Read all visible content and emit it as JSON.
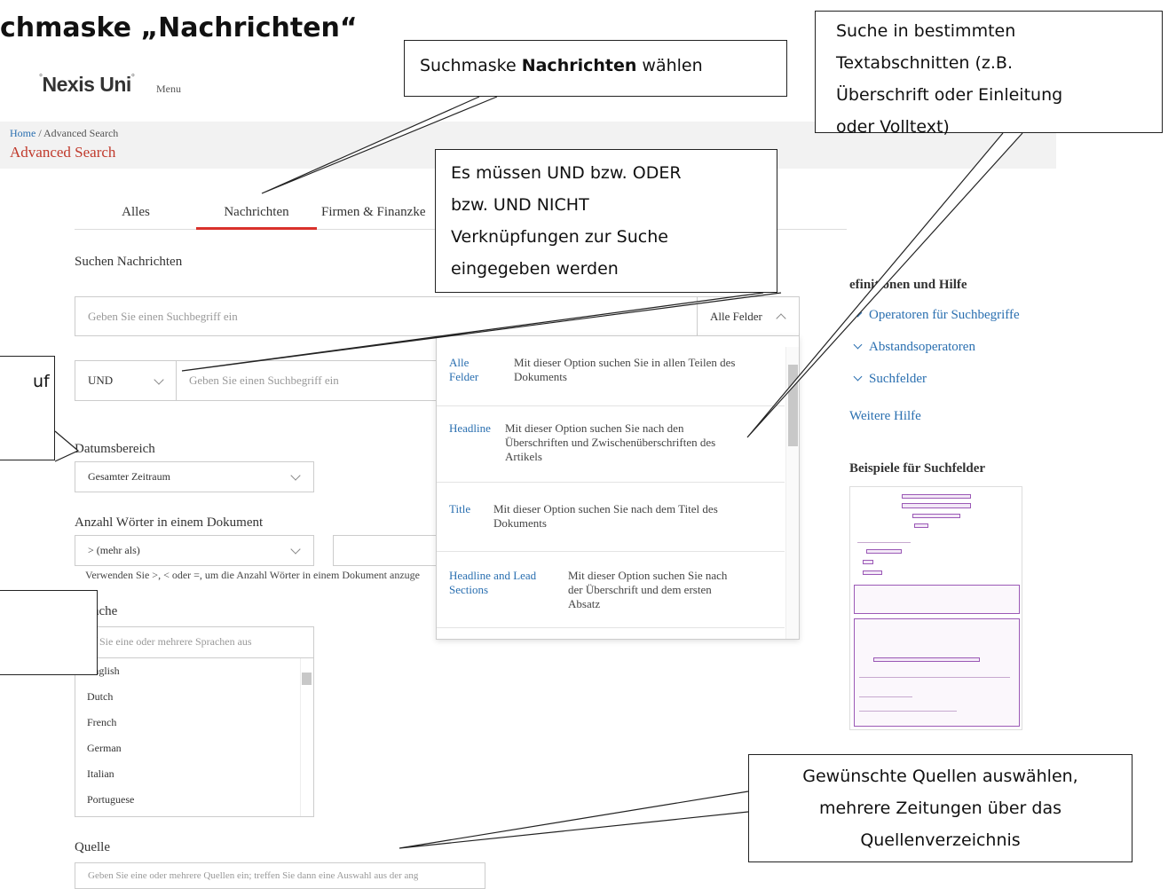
{
  "slide": {
    "title": "chmaske „Nachrichten“"
  },
  "app": {
    "logo": "Nexis Uni",
    "menu_label": "Menu"
  },
  "breadcrumb": {
    "home": "Home",
    "separator": " / ",
    "current": "Advanced Search"
  },
  "page_title": "Advanced Search",
  "tabs": [
    {
      "label": "Alles",
      "active": false
    },
    {
      "label": "Nachrichten",
      "active": true
    },
    {
      "label": "Firmen & Finanzke",
      "active": false
    }
  ],
  "search": {
    "section_label": "Suchen Nachrichten",
    "main_placeholder": "Geben Sie einen Suchbegriff ein",
    "field_select": "Alle Felder",
    "operator": "UND",
    "second_placeholder": "Geben Sie einen Suchbegriff ein"
  },
  "date": {
    "label": "Datumsbereich",
    "value": "Gesamter Zeitraum"
  },
  "word_count": {
    "label": "Anzahl Wörter in einem Dokument",
    "operator": "> (mehr als)",
    "help": "Verwenden Sie >, < oder =, um die Anzahl Wörter in einem Dokument anzuge"
  },
  "language": {
    "label": "Sprache",
    "placeholder": "Sie eine oder mehrere Sprachen aus",
    "options": [
      "English",
      "Dutch",
      "French",
      "German",
      "Italian",
      "Portuguese"
    ]
  },
  "source": {
    "label": "Quelle",
    "placeholder": "Geben Sie eine oder mehrere Quellen ein; treffen Sie dann eine Auswahl aus der ang"
  },
  "field_dropdown": {
    "options": [
      {
        "key_line1": "Alle",
        "key_line2": "Felder",
        "desc_line1": "Mit dieser Option suchen Sie in allen Teilen des",
        "desc_line2": "Dokuments",
        "desc_line3": ""
      },
      {
        "key_line1": "Headline",
        "key_line2": "",
        "desc_line1": "Mit dieser Option suchen Sie nach den",
        "desc_line2": "Überschriften und Zwischenüberschriften des",
        "desc_line3": "Artikels"
      },
      {
        "key_line1": "Title",
        "key_line2": "",
        "desc_line1": "Mit dieser Option suchen Sie nach dem Titel des",
        "desc_line2": "Dokuments",
        "desc_line3": ""
      },
      {
        "key_line1": "Headline and Lead",
        "key_line2": "Sections",
        "desc_line1": "Mit dieser Option suchen Sie nach",
        "desc_line2": "der Überschrift und dem ersten",
        "desc_line3": "Absatz"
      }
    ]
  },
  "sidebar": {
    "title": "efinitionen und Hilfe",
    "links": [
      "Operatoren für Suchbegriffe",
      "Abstandsoperatoren",
      "Suchfelder"
    ],
    "more_help": "Weitere Hilfe",
    "examples_title": "Beispiele für Suchfelder"
  },
  "callouts": {
    "select_news_pre": "Suchmaske ",
    "select_news_bold": "Nachrichten",
    "select_news_post": " wählen",
    "operators": [
      "Es müssen UND bzw. ODER",
      "bzw. UND NICHT",
      "Verknüpfungen zur Suche",
      "eingegeben werden"
    ],
    "sections": [
      "Suche in bestimmten",
      "Textabschnitten (z.B.",
      "Überschrift oder Einleitung",
      "oder Volltext)"
    ],
    "left_fragment": "uf",
    "sources": [
      "Gewünschte Quellen auswählen,",
      "mehrere Zeitungen über das",
      "Quellenverzeichnis"
    ]
  },
  "colors": {
    "accent_red": "#d9312b",
    "link_blue": "#2a6fb0"
  }
}
